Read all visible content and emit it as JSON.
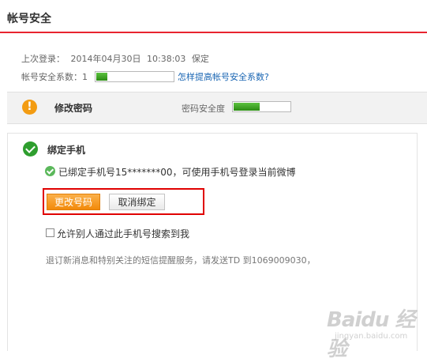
{
  "header": {
    "title": "帐号安全"
  },
  "login": {
    "label": "上次登录：",
    "date": "2014年04月30日",
    "time": "10:38:03",
    "location": "保定"
  },
  "security_score": {
    "label": "帐号安全系数：",
    "value": "1",
    "level_fraction": 0.08,
    "link": "怎样提高帐号安全系数?"
  },
  "password": {
    "title": "修改密码",
    "strength_label": "密码安全度",
    "strength_fraction": 0.45
  },
  "phone": {
    "title": "绑定手机",
    "bound_text": "已绑定手机号15*******00，可使用手机号登录当前微博",
    "change_button": "更改号码",
    "unbind_button": "取消绑定",
    "search_checkbox_label": "允许别人通过此手机号搜索到我",
    "search_checkbox_checked": false,
    "unsubscribe_text": "退订新消息和特别关注的短信提醒服务，请发送TD 到1069009030，"
  },
  "watermark": {
    "logo_text": "Baidu 经验",
    "url_text": "jingyan.baidu.com"
  },
  "colors": {
    "accent_red": "#e8242f",
    "orange_button": "#f7941d",
    "meter_green": "#3aa120",
    "link_blue": "#1a66b3"
  },
  "icons": {
    "password_status": "warning-icon",
    "phone_status": "check-circle-icon",
    "bound_status": "check-small-icon"
  }
}
